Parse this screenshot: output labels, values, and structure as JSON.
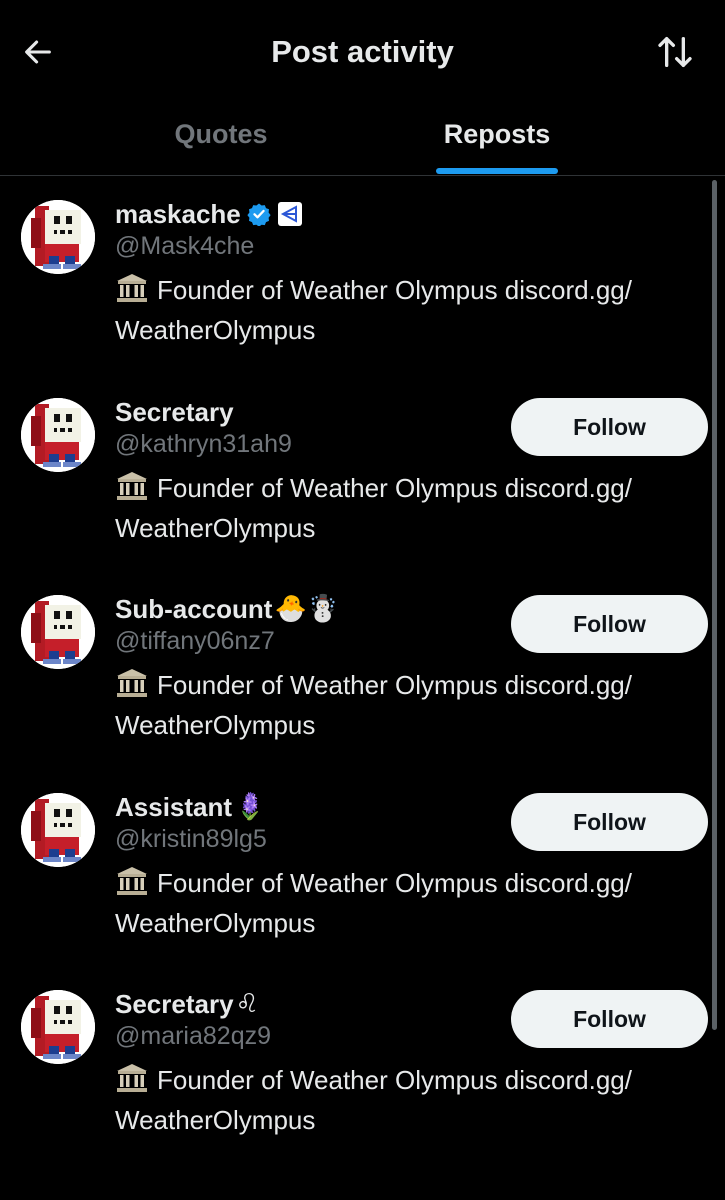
{
  "header": {
    "title": "Post activity",
    "back_icon": "arrow-left-icon",
    "sort_icon": "sort-arrows-icon"
  },
  "tabs": [
    {
      "label": "Quotes",
      "active": false
    },
    {
      "label": "Reposts",
      "active": true
    }
  ],
  "colors": {
    "background": "#000000",
    "accent": "#1d9bf0",
    "text": "#e7e9ea",
    "muted": "#71767b",
    "button_bg": "#eff3f4"
  },
  "users": [
    {
      "name": "maskache",
      "name_emoji": "",
      "handle": "@Mask4che",
      "verified": true,
      "affiliate_badge": true,
      "bio_icon": "classical-building-icon",
      "bio": "Founder of Weather Olympus discord.gg/ WeatherOlympus",
      "follow_label": ""
    },
    {
      "name": "Secretary",
      "name_emoji": "",
      "handle": "@kathryn31ah9",
      "verified": false,
      "affiliate_badge": false,
      "bio_icon": "classical-building-icon",
      "bio": "Founder of Weather Olympus discord.gg/ WeatherOlympus",
      "follow_label": "Follow"
    },
    {
      "name": "Sub-account",
      "name_emoji": "🐣☃️",
      "handle": "@tiffany06nz7",
      "verified": false,
      "affiliate_badge": false,
      "bio_icon": "classical-building-icon",
      "bio": "Founder of Weather Olympus discord.gg/ WeatherOlympus",
      "follow_label": "Follow"
    },
    {
      "name": "Assistant",
      "name_emoji": "🪻",
      "handle": "@kristin89lg5",
      "verified": false,
      "affiliate_badge": false,
      "bio_icon": "classical-building-icon",
      "bio": "Founder of Weather Olympus discord.gg/ WeatherOlympus",
      "follow_label": "Follow"
    },
    {
      "name": "Secretary",
      "name_emoji": "♌",
      "handle": "@maria82qz9",
      "verified": false,
      "affiliate_badge": false,
      "bio_icon": "classical-building-icon",
      "bio": "Founder of Weather Olympus discord.gg/ WeatherOlympus",
      "follow_label": "Follow"
    }
  ]
}
